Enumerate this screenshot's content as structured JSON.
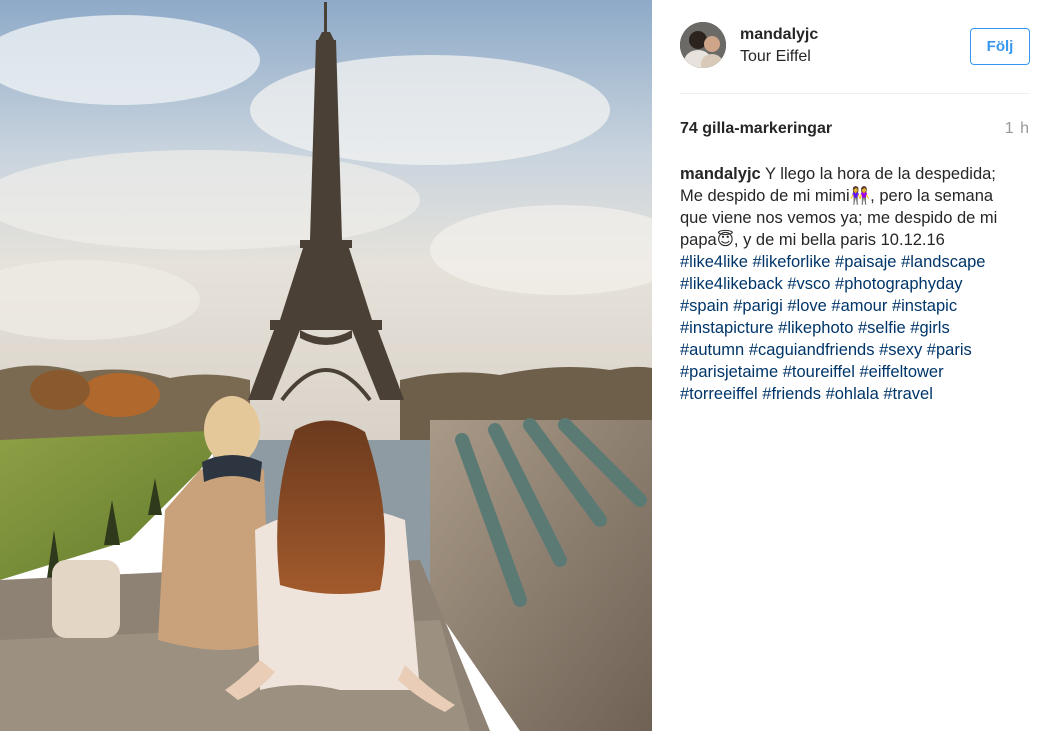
{
  "post": {
    "username": "mandalyjc",
    "location": "Tour Eiffel",
    "follow_label": "Följ",
    "likes": "74 gilla-markeringar",
    "time": "1 h",
    "caption_lines": [
      "Y llego la hora de la despedida;",
      "Me despido de mi mimi👭, pero la semana",
      "que viene nos vemos ya; me despido de mi",
      "papa😇, y de mi bella paris 10.12.16"
    ],
    "hashtag_lines": [
      [
        "#like4like",
        "#likeforlike",
        "#paisaje",
        "#landscape"
      ],
      [
        "#like4likeback",
        "#vsco",
        "#photographyday"
      ],
      [
        "#spain",
        "#parigi",
        "#love",
        "#amour",
        "#instapic"
      ],
      [
        "#instapicture",
        "#likephoto",
        "#selfie",
        "#girls"
      ],
      [
        "#autumn",
        "#caguiandfriends",
        "#sexy",
        "#paris"
      ],
      [
        "#parisjetaime",
        "#toureiffel",
        "#eiffeltower"
      ],
      [
        "#torreeiffel",
        "#friends",
        "#ohlala",
        "#travel"
      ]
    ]
  },
  "colors": {
    "link": "#003569",
    "follow": "#3897f0",
    "muted": "#999999"
  },
  "icons": {
    "avatar": "profile-photo"
  }
}
